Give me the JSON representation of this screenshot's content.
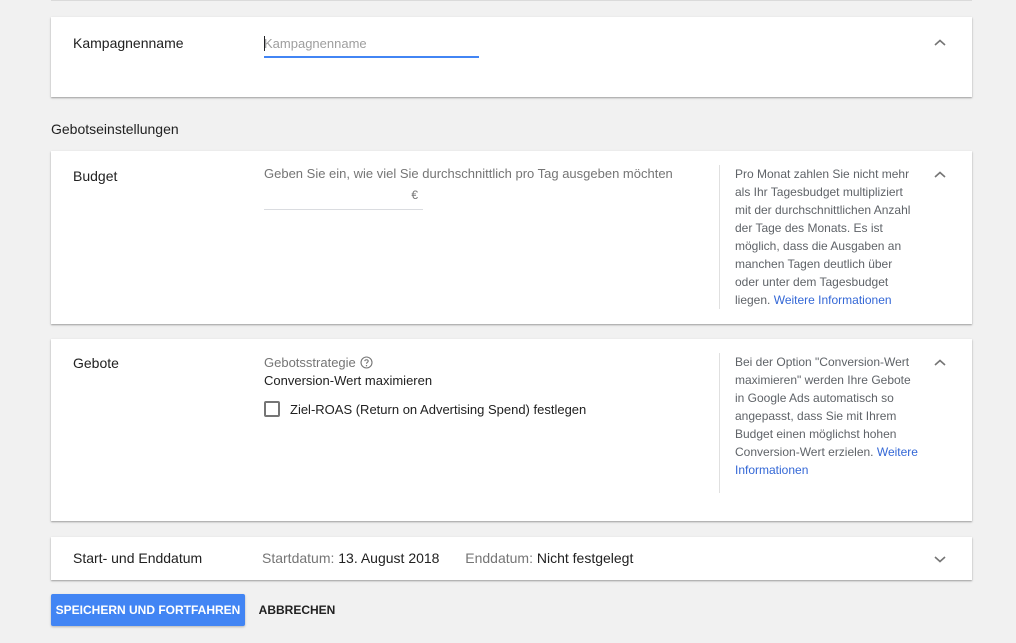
{
  "campaign_name": {
    "label": "Kampagnenname",
    "placeholder": "Kampagnenname",
    "value": ""
  },
  "section_heading": "Gebotseinstellungen",
  "budget": {
    "label": "Budget",
    "hint": "Geben Sie ein, wie viel Sie durchschnittlich pro Tag ausgeben möchten",
    "currency": "€",
    "value": "",
    "help_text": "Pro Monat zahlen Sie nicht mehr als Ihr Tagesbudget multipliziert mit der durchschnittlichen Anzahl der Tage des Monats. Es ist möglich, dass die Ausgaben an manchen Tagen deutlich über oder unter dem Tagesbudget liegen. ",
    "help_link": "Weitere Informationen"
  },
  "bids": {
    "label": "Gebote",
    "strategy_label": "Gebotsstrategie",
    "strategy_value": "Conversion-Wert maximieren",
    "checkbox_label": "Ziel-ROAS (Return on Advertising Spend) festlegen",
    "checkbox_checked": false,
    "help_text": "Bei der Option \"Conversion-Wert maximieren\" werden Ihre Gebote in Google Ads automatisch so angepasst, dass Sie mit Ihrem Budget einen möglichst hohen Conversion-Wert erzielen. ",
    "help_link": "Weitere Informationen"
  },
  "dates": {
    "label": "Start- und Enddatum",
    "start_label": "Startdatum:",
    "start_value": "13. August 2018",
    "end_label": "Enddatum:",
    "end_value": "Nicht festgelegt"
  },
  "actions": {
    "save_label": "SPEICHERN UND FORTFAHREN",
    "cancel_label": "ABBRECHEN"
  },
  "colors": {
    "primary": "#4285f4",
    "link": "#3367d6",
    "background": "#f1f1f1"
  },
  "icons": [
    "chevron-up-icon",
    "chevron-down-icon",
    "help-circle-icon",
    "checkbox-icon"
  ]
}
